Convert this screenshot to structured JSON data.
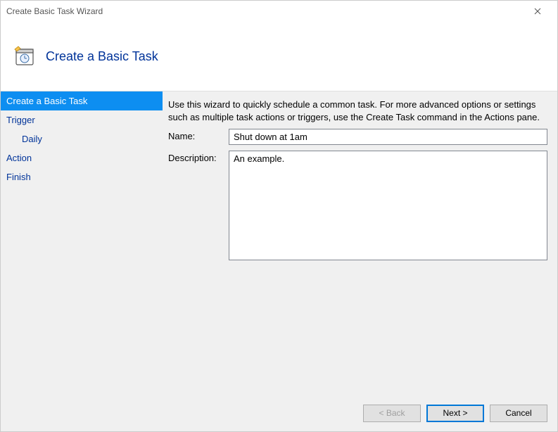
{
  "window": {
    "title": "Create Basic Task Wizard"
  },
  "header": {
    "title": "Create a Basic Task"
  },
  "sidebar": {
    "items": [
      {
        "label": "Create a Basic Task",
        "active": true,
        "indent": false
      },
      {
        "label": "Trigger",
        "active": false,
        "indent": false
      },
      {
        "label": "Daily",
        "active": false,
        "indent": true
      },
      {
        "label": "Action",
        "active": false,
        "indent": false
      },
      {
        "label": "Finish",
        "active": false,
        "indent": false
      }
    ]
  },
  "content": {
    "intro": "Use this wizard to quickly schedule a common task.  For more advanced options or settings such as multiple task actions or triggers, use the Create Task command in the Actions pane.",
    "name_label": "Name:",
    "name_value": "Shut down at 1am",
    "desc_label": "Description:",
    "desc_value": "An example."
  },
  "footer": {
    "back": "< Back",
    "next": "Next >",
    "cancel": "Cancel"
  }
}
